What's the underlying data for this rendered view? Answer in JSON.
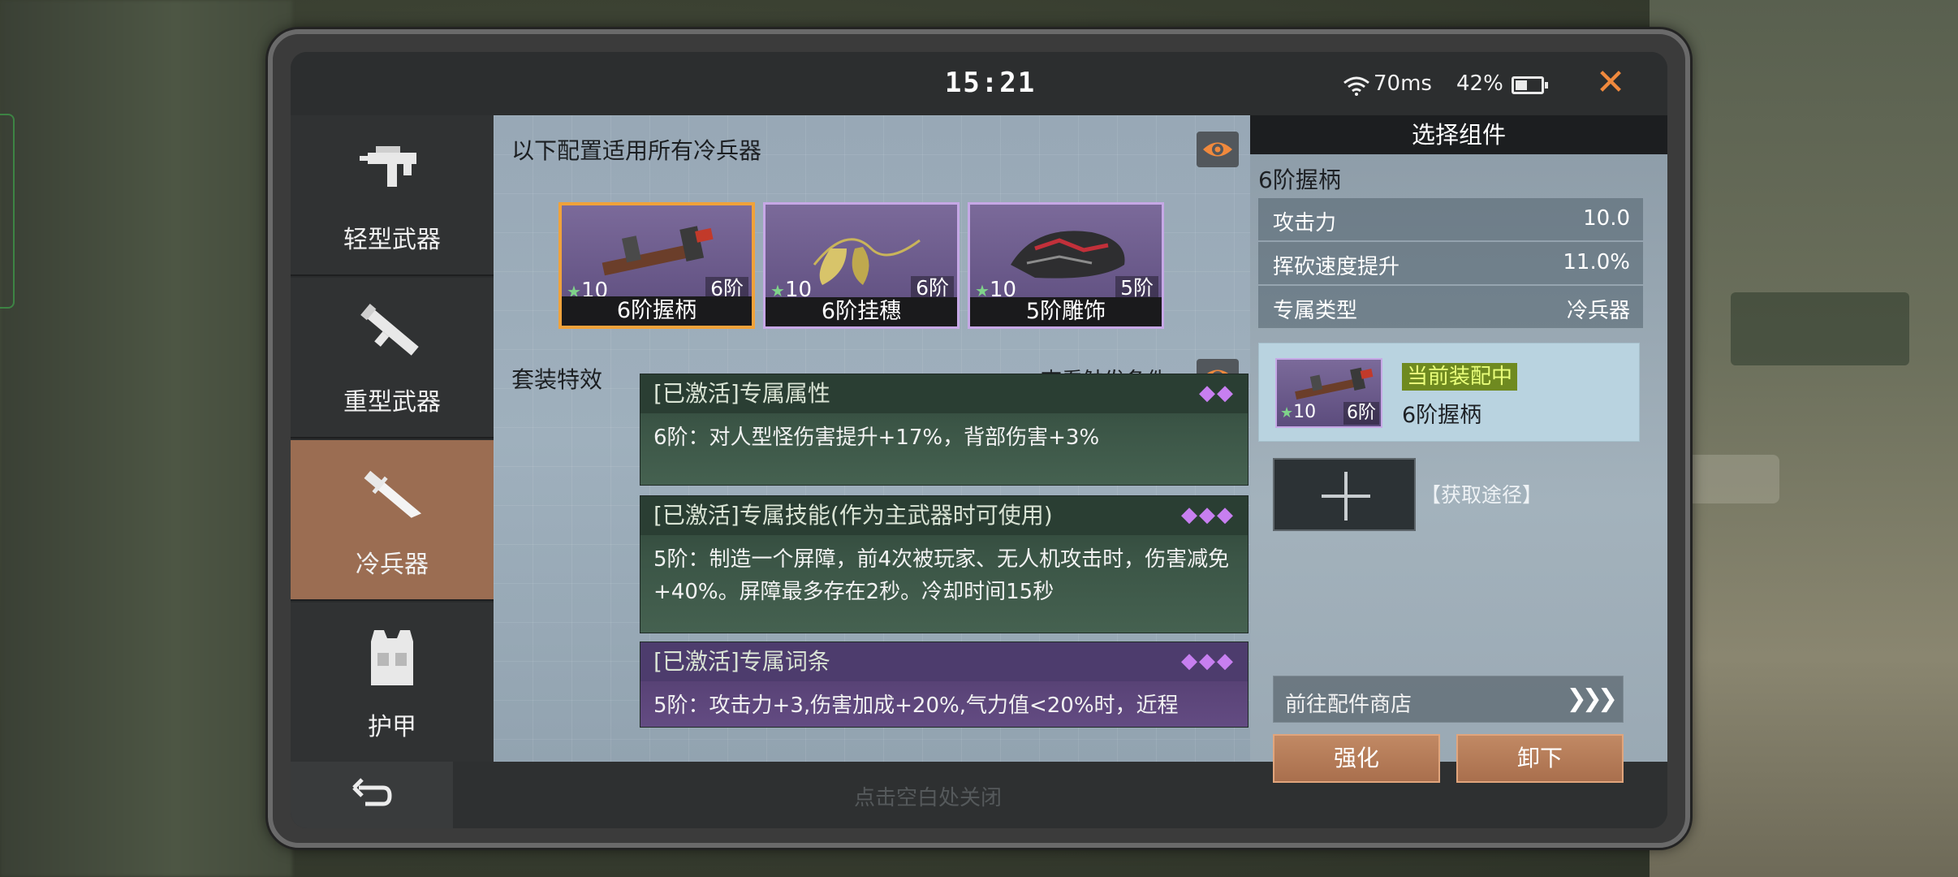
{
  "status_bar": {
    "time": "15:21",
    "ping": "70ms",
    "battery": "42%",
    "close_icon": "close-x-icon"
  },
  "left_nav": {
    "items": [
      {
        "label": "轻型武器",
        "icon": "smg-icon",
        "active": false
      },
      {
        "label": "重型武器",
        "icon": "rocket-launcher-icon",
        "active": false
      },
      {
        "label": "冷兵器",
        "icon": "knife-icon",
        "active": true
      },
      {
        "label": "护甲",
        "icon": "vest-icon",
        "active": false
      }
    ],
    "back_icon": "back-arrow-icon"
  },
  "close_hint": "点击空白处关闭",
  "center": {
    "title": "以下配置适用所有冷兵器",
    "items": [
      {
        "name": "6阶握柄",
        "level": "10",
        "tier": "6阶",
        "selected": true
      },
      {
        "name": "6阶挂穗",
        "level": "10",
        "tier": "6阶",
        "selected": false
      },
      {
        "name": "5阶雕饰",
        "level": "10",
        "tier": "5阶",
        "selected": false
      }
    ],
    "set_title": "套装特效",
    "trigger_label": "查看触发条件",
    "effects": [
      {
        "header": "[已激活]专属属性",
        "dots": "◆◆",
        "body": "6阶：对人型怪伤害提升+17%，背部伤害+3%",
        "color": "#3f5a4c"
      },
      {
        "header": "[已激活]专属技能(作为主武器时可使用)",
        "dots": "◆◆◆",
        "body": "5阶：制造一个屏障，前4次被玩家、无人机攻击时，伤害减免+40%。屏障最多存在2秒。冷却时间15秒",
        "color": "#3f5a4c"
      },
      {
        "header": "[已激活]专属词条",
        "dots": "◆◆◆",
        "body": "5阶：攻击力+3,伤害加成+20%,气力值<20%时，近程",
        "color": "#5a4478"
      }
    ]
  },
  "right": {
    "header": "选择组件",
    "subtitle": "6阶握柄",
    "stats": [
      {
        "key": "攻击力",
        "value": "10.0"
      },
      {
        "key": "挥砍速度提升",
        "value": "11.0%"
      },
      {
        "key": "专属类型",
        "value": "冷兵器"
      }
    ],
    "equipped": {
      "badge": "当前装配中",
      "name": "6阶握柄",
      "level": "10",
      "tier": "6阶"
    },
    "obtain_label": "【获取途径】",
    "shop_label": "前往配件商店",
    "shop_arrows": "❯❯❯",
    "buttons": {
      "upgrade": "强化",
      "unequip": "卸下"
    }
  }
}
